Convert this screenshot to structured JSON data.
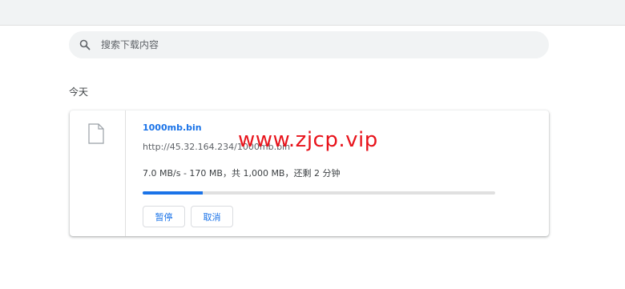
{
  "search": {
    "placeholder": "搜索下载内容"
  },
  "section": {
    "title": "今天"
  },
  "download": {
    "file_name": "1000mb.bin",
    "url": "http://45.32.164.234/1000mb.bin",
    "status": "7.0 MB/s - 170 MB，共 1,000 MB，还剩 2 分钟",
    "progress": 0.17,
    "pause_label": "暂停",
    "cancel_label": "取消"
  },
  "watermark": {
    "text": "www.zjcp.vip"
  },
  "colors": {
    "accent": "#1a73e8",
    "watermark": "#e8141c"
  },
  "icons": {
    "search": "search-icon",
    "file": "file-icon"
  }
}
